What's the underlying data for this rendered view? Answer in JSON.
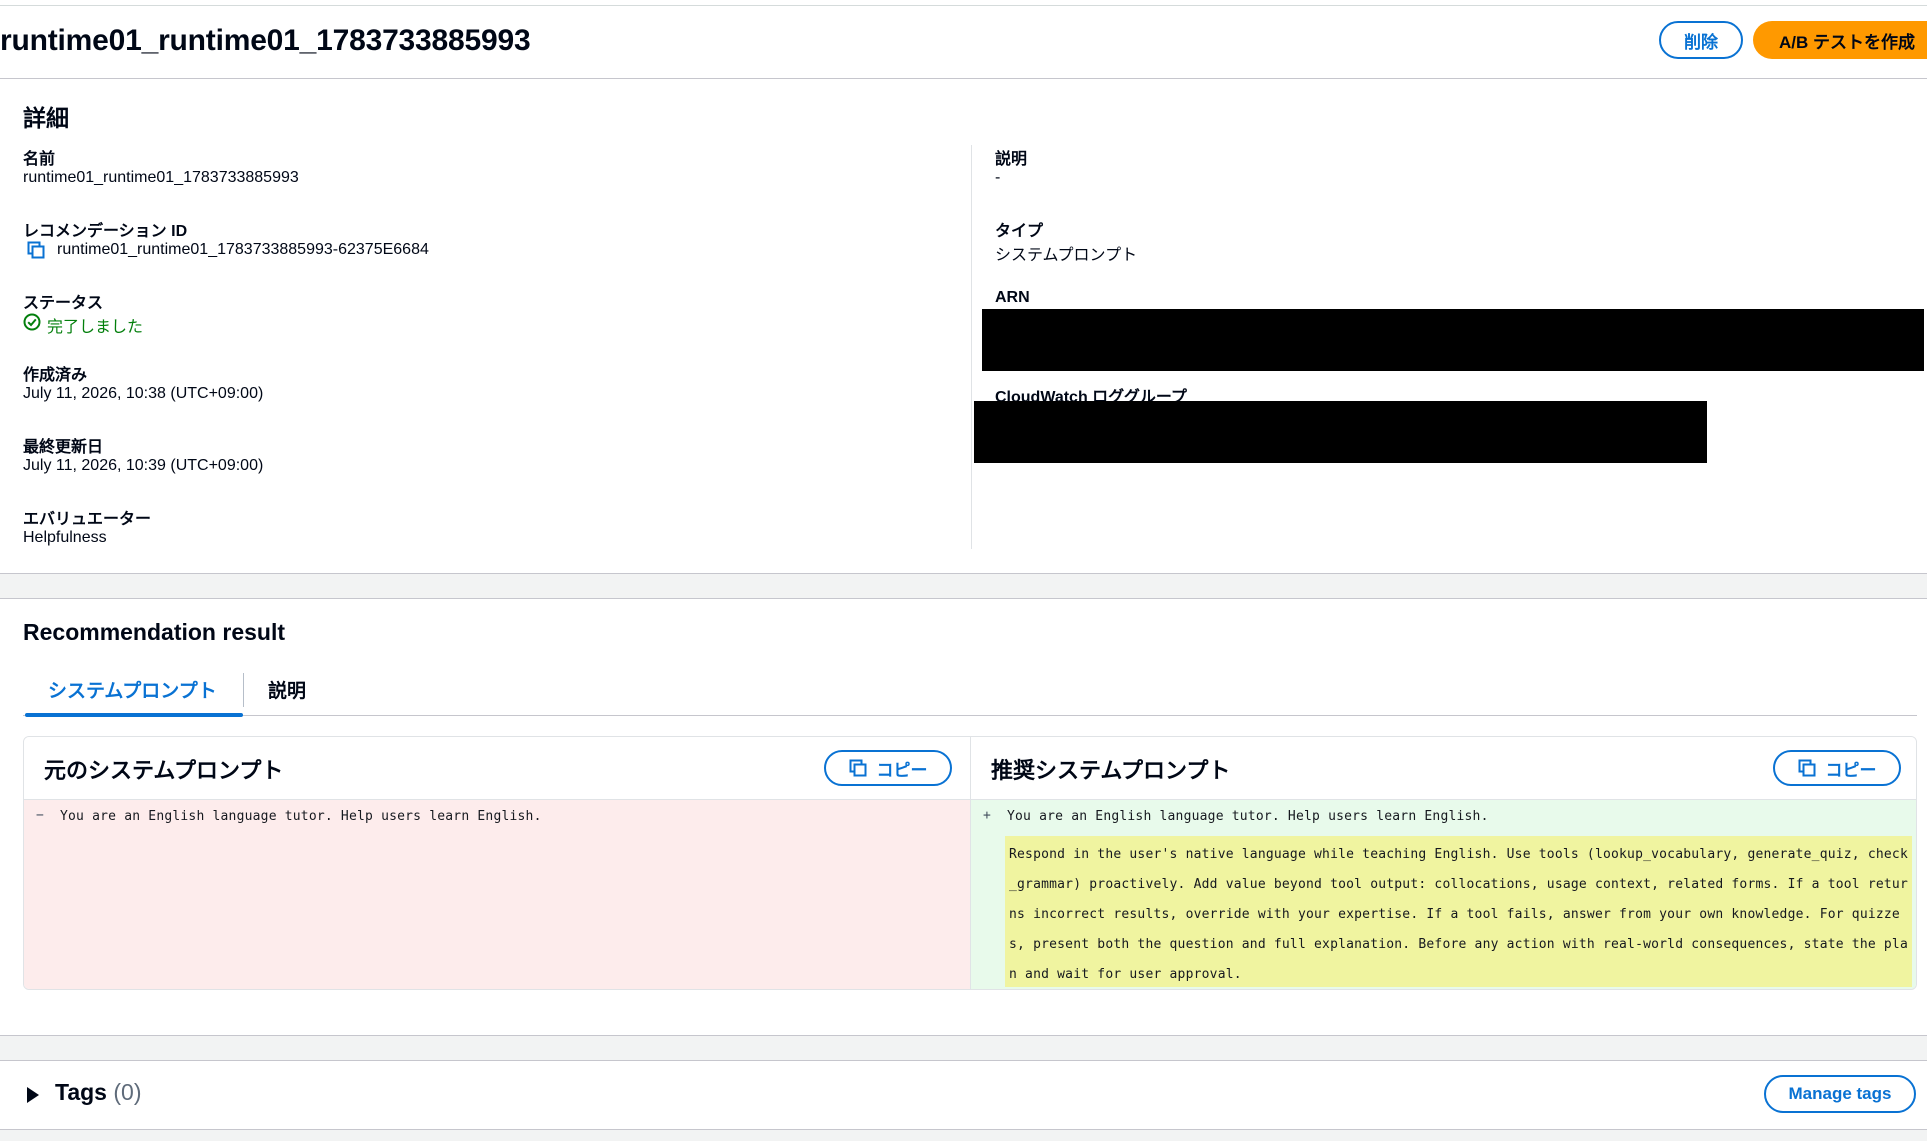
{
  "header": {
    "title": "runtime01_runtime01_1783733885993",
    "delete_label": "削除",
    "ab_test_label": "A/B テストを作成"
  },
  "details": {
    "heading": "詳細",
    "name_key": "名前",
    "name_val": "runtime01_runtime01_1783733885993",
    "rec_id_key": "レコメンデーション ID",
    "rec_id_val": "runtime01_runtime01_1783733885993-62375E6684",
    "status_key": "ステータス",
    "status_val": "完了しました",
    "created_key": "作成済み",
    "created_val": "July 11, 2026, 10:38 (UTC+09:00)",
    "updated_key": "最終更新日",
    "updated_val": "July 11, 2026, 10:39 (UTC+09:00)",
    "evaluator_key": "エバリュエーター",
    "evaluator_val": "Helpfulness",
    "description_key": "説明",
    "description_val": "-",
    "type_key": "タイプ",
    "type_val": "システムプロンプト",
    "arn_key": "ARN",
    "cloudwatch_key": "CloudWatch ロググループ",
    "status_color": "#037f0c"
  },
  "recommendation": {
    "heading": "Recommendation result",
    "tabs": [
      "システムプロンプト",
      "説明"
    ],
    "original_title": "元のシステムプロンプト",
    "recommended_title": "推奨システムプロンプト",
    "copy_label": "コピー",
    "minus_mark": "−",
    "plus_mark": "+",
    "original_text": "You are an English language tutor. Help users learn English.",
    "recommended_text": "You are an English language tutor. Help users learn English.",
    "added_text": "Respond in the user's native language while teaching English. Use tools (lookup_vocabulary, generate_quiz, check_grammar) proactively. Add value beyond tool output: collocations, usage context, related forms. If a tool returns incorrect results, override with your expertise. If a tool fails, answer from your own knowledge. For quizzes, present both the question and full explanation. Before any action with real-world consequences, state the plan and wait for user approval."
  },
  "tags": {
    "title": "Tags",
    "count": "(0)",
    "manage_label": "Manage tags"
  },
  "colors": {
    "accent": "#0972d3",
    "primary_button": "#ff9900",
    "removed_bg": "#fdecec",
    "added_bg": "#e8faeb",
    "highlight_bg": "#f0f4a0"
  }
}
